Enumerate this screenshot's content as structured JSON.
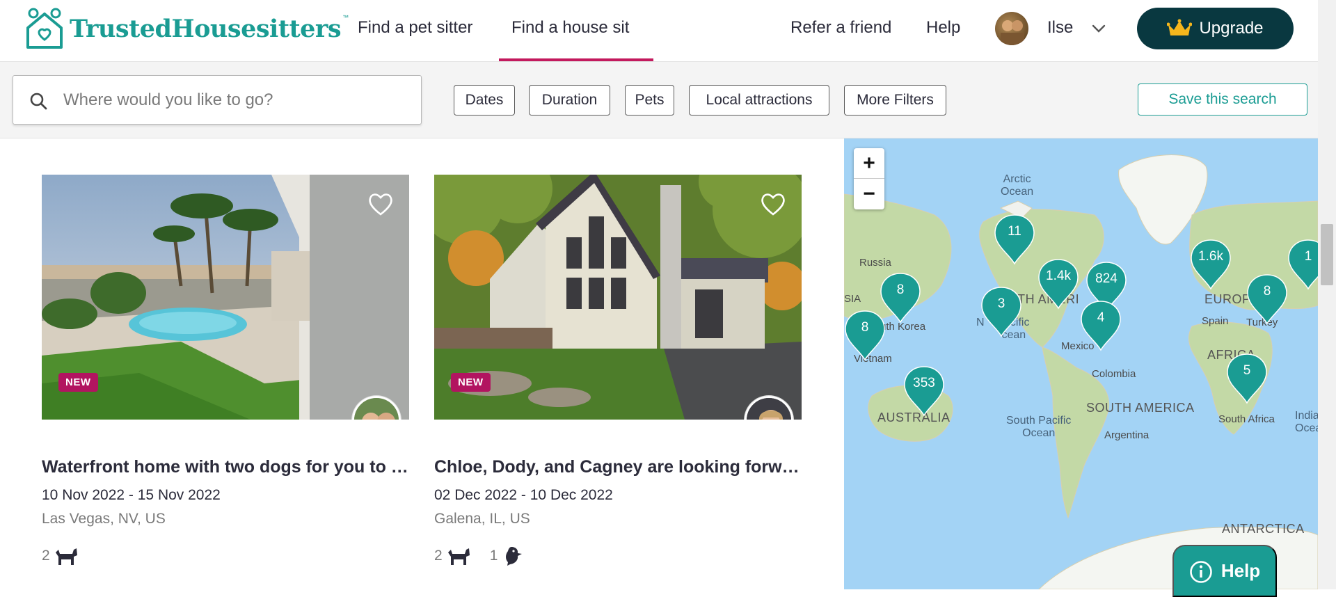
{
  "header": {
    "logo_text": "TrustedHousesitters",
    "logo_tm": "™",
    "nav": [
      {
        "label": "Find a pet sitter",
        "active": false
      },
      {
        "label": "Find a house sit",
        "active": true
      }
    ],
    "refer_label": "Refer a friend",
    "help_label": "Help",
    "user_name": "Ilse",
    "upgrade_label": "Upgrade"
  },
  "filters": {
    "search_placeholder": "Where would you like to go?",
    "chips": [
      "Dates",
      "Duration",
      "Pets",
      "Local attractions",
      "More Filters"
    ],
    "save_label": "Save this search"
  },
  "listings": [
    {
      "title": "Waterfront home with two dogs for you to …",
      "dates": "10 Nov 2022 - 15 Nov 2022",
      "location": "Las Vegas, NV, US",
      "badge": "NEW",
      "pets": [
        {
          "count": "2",
          "icon": "dog-icon"
        }
      ]
    },
    {
      "title": "Chloe, Dody, and Cagney are looking forw…",
      "dates": "02 Dec 2022 - 10 Dec 2022",
      "location": "Galena, IL, US",
      "badge": "NEW",
      "pets": [
        {
          "count": "2",
          "icon": "dog-icon"
        },
        {
          "count": "1",
          "icon": "bird-icon"
        }
      ]
    }
  ],
  "map": {
    "zoom_in": "+",
    "zoom_out": "−",
    "labels": {
      "arctic": "Arctic\nOcean",
      "russia": "Russia",
      "asia": "SIA",
      "south_korea": "uth Korea",
      "north_america": "NORTH AMERI",
      "n_pacific": "N    Pacific\n       cean",
      "mexico": "Mexico",
      "colombia": "Colombia",
      "south_america": "SOUTH AMERICA",
      "s_pacific": "South Pacific\nOcean",
      "argentina": "Argentina",
      "australia": "AUSTRALIA",
      "vietnam": "Vietnam",
      "europe": "EUROPE",
      "spain": "Spain",
      "turkey": "Turkey",
      "africa": "AFRICA",
      "south_africa": "South Africa",
      "indian": "India\nOcea",
      "antarctica": "ANTARCTICA",
      "p": "P"
    },
    "clusters": [
      "11",
      "1.4k",
      "824",
      "3",
      "4",
      "8",
      "8",
      "353",
      "1.6k",
      "8",
      "1",
      "5"
    ]
  },
  "help_widget_label": "Help",
  "colors": {
    "brand_teal": "#1a9c93",
    "upgrade_bg": "#093840",
    "active_nav": "#c3195d",
    "new_badge": "#b21460",
    "map_water": "#a3d3f5"
  }
}
